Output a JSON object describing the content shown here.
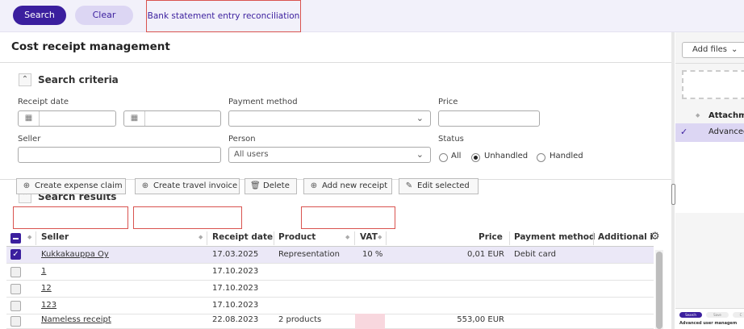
{
  "toolbar": {
    "search_label": "Search",
    "clear_label": "Clear",
    "tab_bank": "Bank statement entry reconciliation"
  },
  "page": {
    "title": "Cost receipt management"
  },
  "criteria": {
    "section_title": "Search criteria",
    "receipt_date_label": "Receipt date",
    "payment_method_label": "Payment method",
    "price_label": "Price",
    "seller_label": "Seller",
    "person_label": "Person",
    "person_value": "All users",
    "status_label": "Status",
    "status_options": [
      "All",
      "Unhandled",
      "Handled"
    ],
    "status_selected": "Unhandled"
  },
  "results": {
    "section_title": "Search results",
    "actions": {
      "create_expense": "Create expense claim",
      "create_travel": "Create travel invoice",
      "delete": "Delete",
      "add_receipt": "Add new receipt",
      "edit_selected": "Edit selected"
    },
    "columns": {
      "seller": "Seller",
      "receipt_date": "Receipt date",
      "product": "Product",
      "vat": "VAT",
      "price": "Price",
      "payment_method": "Payment method",
      "additional": "Additional i"
    },
    "rows": [
      {
        "seller": "Kukkakauppa Oy",
        "date": "17.03.2025",
        "product": "Representation",
        "vat": "10 %",
        "price": "0,01 EUR",
        "payment": "Debit card",
        "selected": true
      },
      {
        "seller": "1",
        "date": "17.10.2023",
        "product": "",
        "vat": "",
        "price": "",
        "payment": "",
        "selected": false
      },
      {
        "seller": "12",
        "date": "17.10.2023",
        "product": "",
        "vat": "",
        "price": "",
        "payment": "",
        "selected": false
      },
      {
        "seller": "123",
        "date": "17.10.2023",
        "product": "",
        "vat": "",
        "price": "",
        "payment": "",
        "selected": false
      },
      {
        "seller": "Nameless receipt",
        "date": "22.08.2023",
        "product": "2 products",
        "vat": "",
        "price": "553,00 EUR",
        "payment": "",
        "selected": false
      }
    ]
  },
  "attachments": {
    "add_files_label": "Add files",
    "column_header": "Attachme",
    "row_name": "Advanced",
    "thumb_buttons": [
      "Search",
      "Save",
      "C"
    ],
    "thumb_title": "Advanced user managem"
  },
  "icons": {
    "calendar": "calendar-icon",
    "chevron": "chevron-down-icon",
    "collapse": "chevron-up-icon",
    "gear": "gear-icon",
    "trash": "trash-icon",
    "plus_circle": "plus-circle-icon",
    "edit": "edit-icon",
    "check": "check-icon"
  },
  "colors": {
    "accent": "#3b1f9e",
    "accent_light": "#dcd6f3",
    "highlight_box": "#d9534f",
    "selected_row": "#ebe8f7",
    "vat_warning": "#f8d7de"
  }
}
